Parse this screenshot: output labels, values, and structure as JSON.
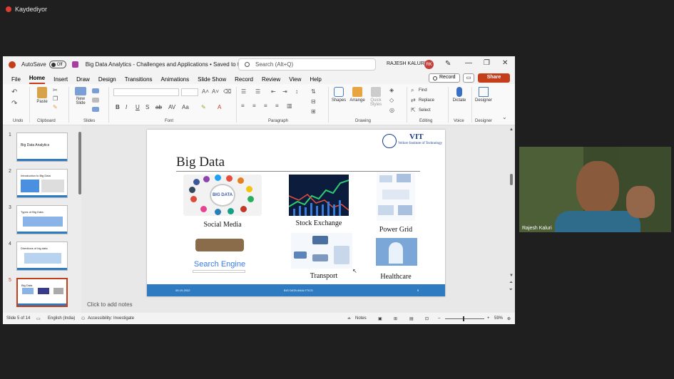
{
  "recording": {
    "label": "Kaydediyor"
  },
  "titlebar": {
    "autosave_label": "AutoSave",
    "autosave_state": "Off",
    "doc_title": "Big Data Analytics - Challenges and Applications • Saved to this PC ⌄",
    "search_placeholder": "Search (Alt+Q)",
    "user_name": "RAJESH KALURI",
    "user_initials": "RK"
  },
  "menu": {
    "tabs": [
      "File",
      "Home",
      "Insert",
      "Draw",
      "Design",
      "Transitions",
      "Animations",
      "Slide Show",
      "Record",
      "Review",
      "View",
      "Help"
    ],
    "active_tab": "Home",
    "record_label": "Record",
    "share_label": "Share"
  },
  "ribbon": {
    "groups": {
      "undo": "Undo",
      "clipboard": "Clipboard",
      "slides": "Slides",
      "font": "Font",
      "paragraph": "Paragraph",
      "drawing": "Drawing",
      "editing": "Editing",
      "voice": "Voice",
      "designer": "Designer"
    },
    "buttons": {
      "paste": "Paste",
      "new_slide": "New Slide",
      "shapes": "Shapes",
      "arrange": "Arrange",
      "quick_styles": "Quick Styles",
      "find": "Find",
      "replace": "Replace",
      "select": "Select",
      "dictate": "Dictate",
      "designer": "Designer"
    },
    "format": [
      "B",
      "I",
      "U",
      "S",
      "ab",
      "Aa"
    ]
  },
  "thumbnails": [
    {
      "num": "1",
      "title": "Big Data Analytics"
    },
    {
      "num": "2",
      "title": "Introduction to Big Data"
    },
    {
      "num": "3",
      "title": "Types of Big Data"
    },
    {
      "num": "4",
      "title": "Directions of big data"
    },
    {
      "num": "5",
      "title": "Big Data"
    }
  ],
  "slide": {
    "title": "Big Data",
    "logo_name": "VIT",
    "logo_sub": "Vellore Institute of Technology",
    "captions": {
      "social": "Social Media",
      "stock": "Stock Exchange",
      "power": "Power Grid",
      "search": "Search Engine",
      "transport": "Transport",
      "health": "Healthcare"
    },
    "center_text": "BIG DATA",
    "footer_date": "05-10-2022",
    "footer_title": "BIG DATA ANALYTICS",
    "footer_page": "5"
  },
  "notes_placeholder": "Click to add notes",
  "status": {
    "slide_of": "Slide 5 of 14",
    "language": "English (India)",
    "accessibility": "Accessibility: Investigate",
    "notes": "Notes",
    "zoom": "59%"
  },
  "webcam": {
    "name": "Rajesh Kaluri"
  }
}
